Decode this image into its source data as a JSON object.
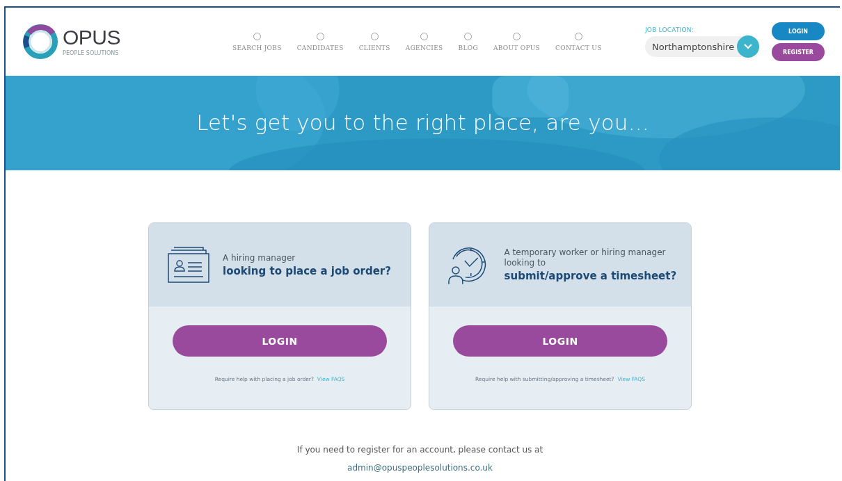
{
  "logo": {
    "name": "OPUS",
    "tagline": "PEOPLE SOLUTIONS"
  },
  "nav": [
    {
      "label": "SEARCH JOBS"
    },
    {
      "label": "CANDIDATES"
    },
    {
      "label": "CLIENTS"
    },
    {
      "label": "AGENCIES"
    },
    {
      "label": "BLOG"
    },
    {
      "label": "ABOUT OPUS"
    },
    {
      "label": "CONTACT US"
    }
  ],
  "job_location": {
    "label": "JOB LOCATION:",
    "value": "Northamptonshire"
  },
  "header_buttons": [
    {
      "label": "LOGIN",
      "kind": "login"
    },
    {
      "label": "REGISTER",
      "kind": "register"
    }
  ],
  "hero": {
    "title": "Let's get you to the right place, are you..."
  },
  "cards": [
    {
      "kind": "job-order",
      "intro": "A hiring manager",
      "question": "looking to place a job order?",
      "button": "LOGIN",
      "help": "Require help with placing a job order?",
      "link": "View FAQS"
    },
    {
      "kind": "timesheet",
      "intro": "A temporary worker or hiring manager looking to",
      "question": "submit/approve a timesheet?",
      "button": "LOGIN",
      "help": "Require help with submitting/approving a timesheet?",
      "link": "View FAQS"
    }
  ],
  "footer": {
    "text": "If you need to register for an account, please contact us at",
    "email": "admin@opuspeoplesolutions.co.uk"
  }
}
